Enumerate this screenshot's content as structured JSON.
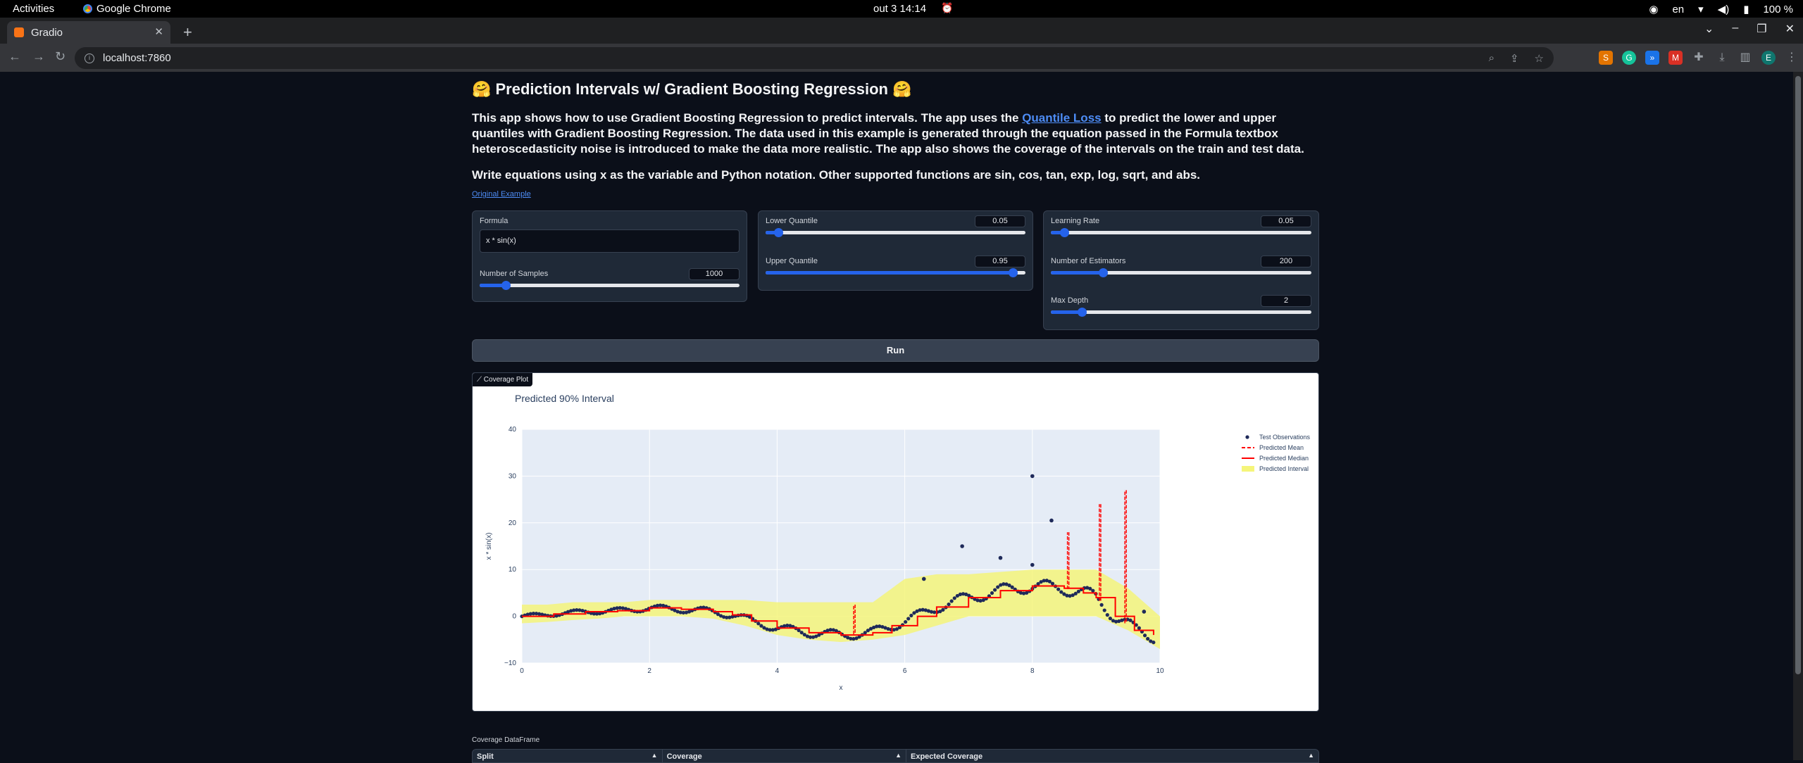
{
  "os": {
    "activities": "Activities",
    "app_name": "Google Chrome",
    "clock": "out 3  14:14",
    "lang": "en",
    "battery": "100 %"
  },
  "browser": {
    "tab_title": "Gradio",
    "url": "localhost:7860"
  },
  "app": {
    "title": "🤗 Prediction Intervals w/ Gradient Boosting Regression 🤗",
    "desc_1": "This app shows how to use Gradient Boosting Regression to predict intervals. The app uses the ",
    "desc_link": "Quantile Loss",
    "desc_2": " to predict the lower and upper quantiles with Gradient Boosting Regression. The data used in this example is generated through the equation passed in the Formula textbox heteroscedasticity noise is introduced to make the data more realistic. The app also shows the coverage of the intervals on the train and test data.",
    "desc_3": "Write equations using x as the variable and Python notation. Other supported functions are sin, cos, tan, exp, log, sqrt, and abs.",
    "original_example": "Original Example",
    "formula_label": "Formula",
    "formula_value": "x * sin(x)",
    "samples_label": "Number of Samples",
    "samples_value": "1000",
    "samples_frac": 0.1,
    "lower_label": "Lower Quantile",
    "lower_value": "0.05",
    "lower_frac": 0.05,
    "upper_label": "Upper Quantile",
    "upper_value": "0.95",
    "upper_frac": 0.95,
    "lr_label": "Learning Rate",
    "lr_value": "0.05",
    "lr_frac": 0.05,
    "est_label": "Number of Estimators",
    "est_value": "200",
    "est_frac": 0.2,
    "depth_label": "Max Depth",
    "depth_value": "2",
    "depth_frac": 0.12,
    "run_label": "Run",
    "plot_tab": "Coverage Plot",
    "df_label": "Coverage DataFrame",
    "df_columns": [
      "Split",
      "Coverage",
      "Expected Coverage"
    ]
  },
  "chart_data": {
    "type": "scatter",
    "title": "Predicted 90% Interval",
    "xlabel": "x",
    "ylabel": "x * sin(x)",
    "xlim": [
      0,
      10
    ],
    "ylim": [
      -10,
      40
    ],
    "xticks": [
      "0",
      "2",
      "4",
      "6",
      "8",
      "10"
    ],
    "yticks": [
      "−10",
      "0",
      "10",
      "20",
      "30",
      "40"
    ],
    "legend": [
      "Test Observations",
      "Predicted Mean",
      "Predicted Median",
      "Predicted Interval"
    ],
    "legend_position": "right",
    "colors": {
      "points": "#1f2a5a",
      "mean": "#ff0000",
      "median": "#ff0000",
      "interval": "#f5f57a",
      "bg": "#e5ecf6"
    },
    "interval": {
      "x": [
        0,
        0.4,
        0.8,
        1.2,
        1.6,
        2.0,
        2.5,
        3.0,
        3.5,
        4.0,
        4.5,
        5.0,
        5.5,
        6.0,
        6.5,
        7.0,
        7.5,
        8.0,
        8.5,
        9.0,
        9.5,
        10.0
      ],
      "lower": [
        -1.5,
        -1.2,
        -0.8,
        -0.5,
        0,
        0,
        0,
        -0.5,
        -2,
        -4,
        -5,
        -5.5,
        -5,
        -4,
        -2,
        0,
        0,
        0,
        0,
        0,
        -3,
        -7
      ],
      "upper": [
        2.5,
        2.5,
        3,
        3,
        3,
        3.5,
        3.5,
        3.5,
        3.5,
        3,
        3,
        3,
        3,
        8,
        9,
        9,
        9.5,
        10,
        10,
        10,
        6,
        0
      ]
    },
    "median": {
      "x": [
        0,
        0.5,
        1.0,
        1.5,
        2.0,
        2.5,
        3.0,
        3.3,
        3.6,
        4.0,
        4.5,
        5.0,
        5.5,
        5.8,
        6.2,
        6.5,
        7.0,
        7.5,
        8.0,
        8.5,
        8.8,
        9.0,
        9.3,
        9.6,
        9.9
      ],
      "y": [
        0,
        0.5,
        1,
        1.2,
        1.8,
        1.5,
        1,
        0.3,
        -1,
        -2.5,
        -3.5,
        -4,
        -3.5,
        -2,
        0,
        2,
        4,
        5.5,
        6.5,
        6,
        5,
        4,
        0,
        -3,
        -4
      ]
    },
    "mean_spikes": [
      {
        "x": 5.2,
        "y": 2.5
      },
      {
        "x": 8.55,
        "y": 18
      },
      {
        "x": 9.05,
        "y": 24
      },
      {
        "x": 9.45,
        "y": 27
      }
    ],
    "outliers": [
      {
        "x": 8.0,
        "y": 30
      },
      {
        "x": 8.3,
        "y": 20.5
      },
      {
        "x": 6.9,
        "y": 15
      },
      {
        "x": 7.5,
        "y": 12.5
      },
      {
        "x": 8.0,
        "y": 11
      },
      {
        "x": 9.75,
        "y": 1
      },
      {
        "x": 6.3,
        "y": 8
      }
    ]
  }
}
